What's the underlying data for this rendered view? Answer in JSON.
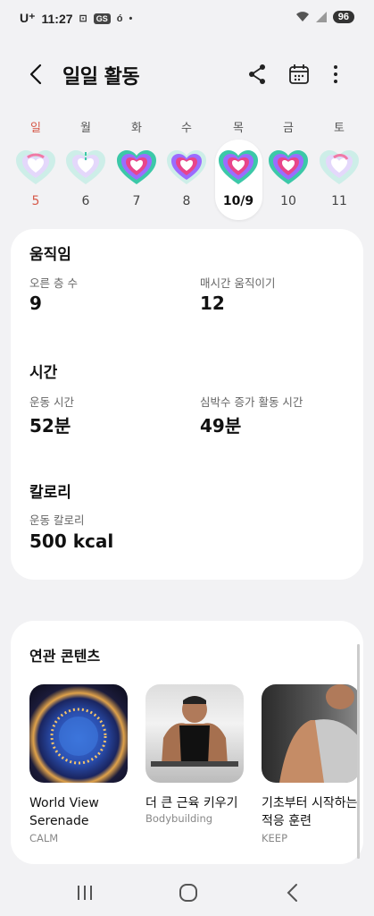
{
  "status_bar": {
    "carrier": "U⁺",
    "time": "11:27",
    "gs": "GS",
    "extra": "ó",
    "dot": "•",
    "battery": "96"
  },
  "header": {
    "title": "일일 활동"
  },
  "week": [
    {
      "label": "일",
      "num": "5",
      "label_color": "#d65a4a",
      "num_color": "#d65a4a",
      "selected": false
    },
    {
      "label": "월",
      "num": "6",
      "selected": false
    },
    {
      "label": "화",
      "num": "7",
      "selected": false
    },
    {
      "label": "수",
      "num": "8",
      "selected": false
    },
    {
      "label": "목",
      "num": "10/9",
      "selected": true
    },
    {
      "label": "금",
      "num": "10",
      "selected": false
    },
    {
      "label": "토",
      "num": "11",
      "selected": false
    }
  ],
  "activity": {
    "movement": {
      "title": "움직임",
      "floors_label": "오른 층 수",
      "floors_value": "9",
      "hourly_label": "매시간 움직이기",
      "hourly_value": "12"
    },
    "time": {
      "title": "시간",
      "exercise_label": "운동 시간",
      "exercise_value": "52분",
      "hr_label": "심박수 증가 활동 시간",
      "hr_value": "49분"
    },
    "calories": {
      "title": "칼로리",
      "cal_label": "운동 칼로리",
      "cal_value": "500 kcal"
    }
  },
  "related": {
    "title": "연관 콘텐츠",
    "items": [
      {
        "line1": "World View",
        "line2": "Serenade",
        "source": "CALM"
      },
      {
        "line1": "더 큰 근육 키우기",
        "line2": "",
        "source": "Bodybuilding"
      },
      {
        "line1": "기초부터 시작하는",
        "line2": "적응 훈련",
        "source": "KEEP"
      }
    ]
  },
  "colors": {
    "accent_red": "#d65a4a",
    "heart_pink": "#e8458b",
    "ring_green": "#3cc8a8",
    "ring_purple": "#9b6cff",
    "background": "#f2f2f4"
  }
}
